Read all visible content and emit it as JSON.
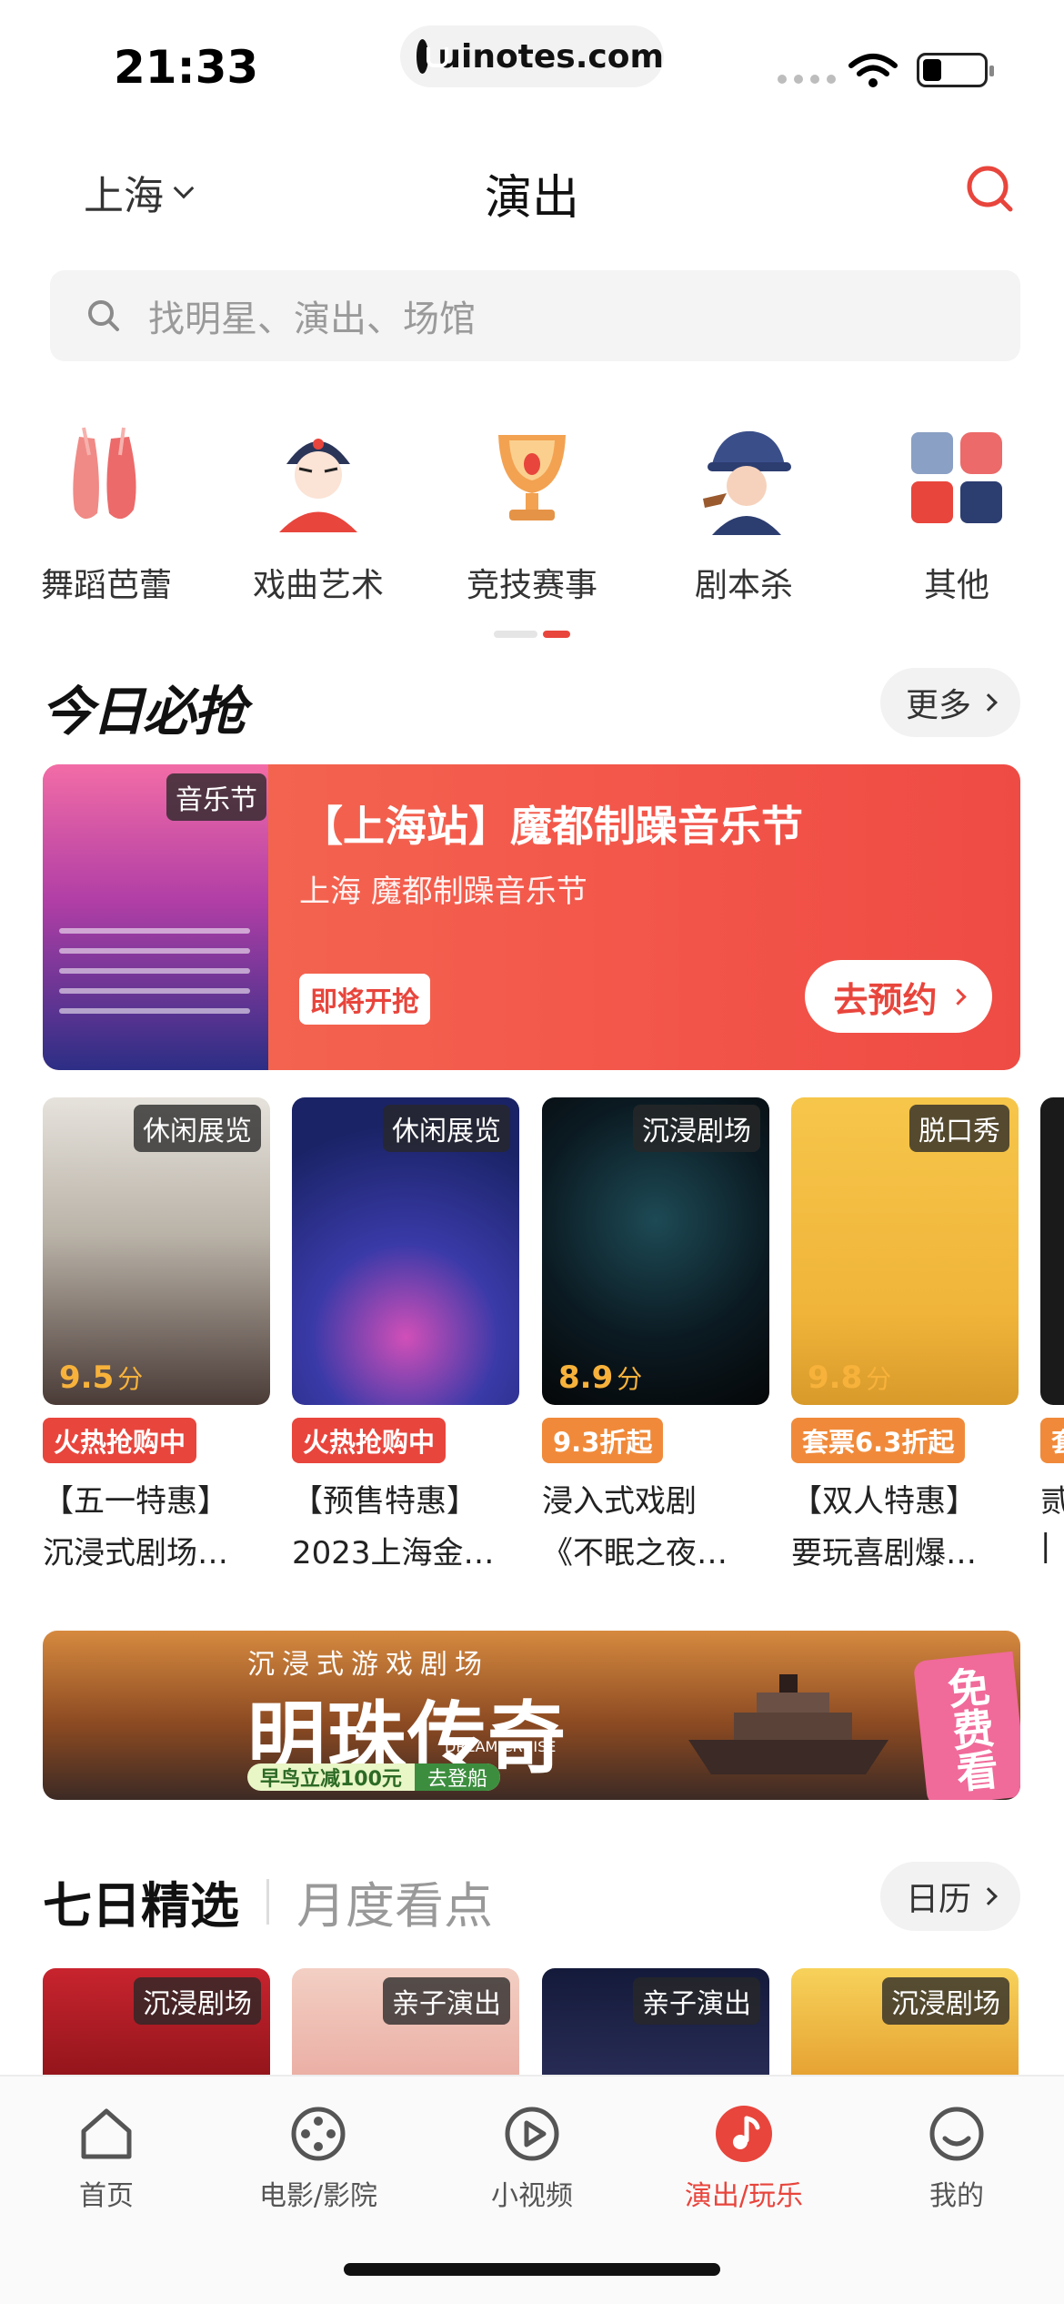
{
  "status_bar": {
    "time": "21:33",
    "url": "uinotes.com"
  },
  "header": {
    "city": "上海",
    "title": "演出"
  },
  "search": {
    "placeholder": "找明星、演出、场馆"
  },
  "categories": [
    {
      "label": "舞蹈芭蕾",
      "icon": "ballet-shoes-icon"
    },
    {
      "label": "戏曲艺术",
      "icon": "opera-mask-icon"
    },
    {
      "label": "竞技赛事",
      "icon": "trophy-icon"
    },
    {
      "label": "剧本杀",
      "icon": "detective-icon"
    },
    {
      "label": "其他",
      "icon": "grid-icon"
    }
  ],
  "today": {
    "title": "今日必抢",
    "more": "更多",
    "featured": {
      "tag": "音乐节",
      "title": "【上海站】魔都制躁音乐节",
      "subtitle": "上海 魔都制躁音乐节",
      "status": "即将开抢",
      "action": "去预约"
    },
    "shows": [
      {
        "tag": "休闲展览",
        "score": "9.5",
        "score_unit": "分",
        "badge": "火热抢购中",
        "badge_color": "#e8453c",
        "line1": "【五一特惠】",
        "line2": "沉浸式剧场…"
      },
      {
        "tag": "休闲展览",
        "score": "",
        "score_unit": "",
        "badge": "火热抢购中",
        "badge_color": "#e8453c",
        "line1": "【预售特惠】",
        "line2": "2023上海金…"
      },
      {
        "tag": "沉浸剧场",
        "score": "8.9",
        "score_unit": "分",
        "badge": "9.3折起",
        "badge_color": "#f08a3a",
        "line1": "浸入式戏剧",
        "line2": "《不眠之夜…"
      },
      {
        "tag": "脱口秀",
        "score": "9.8",
        "score_unit": "分",
        "badge": "套票6.3折起",
        "badge_color": "#f08a3a",
        "line1": "【双人特惠】",
        "line2": "要玩喜剧爆…"
      },
      {
        "tag": "",
        "score": "",
        "score_unit": "",
        "badge": "套",
        "badge_color": "#f08a3a",
        "line1": "贰",
        "line2": "|"
      }
    ]
  },
  "ad": {
    "subtitle": "沉浸式游戏剧场",
    "title": "明珠传奇",
    "english": "DREAM CRUISE",
    "promo": "早鸟立减100元",
    "promo_action": "去登船",
    "side": "免费看"
  },
  "weekly": {
    "tab_active": "七日精选",
    "tab_inactive": "月度看点",
    "calendar": "日历",
    "shows": [
      {
        "tag": "沉浸剧场"
      },
      {
        "tag": "亲子演出"
      },
      {
        "tag": "亲子演出"
      },
      {
        "tag": "沉浸剧场"
      }
    ]
  },
  "tabbar": [
    {
      "label": "首页",
      "icon": "home-icon",
      "active": false
    },
    {
      "label": "电影/影院",
      "icon": "film-reel-icon",
      "active": false
    },
    {
      "label": "小视频",
      "icon": "play-icon",
      "active": false
    },
    {
      "label": "演出/玩乐",
      "icon": "music-note-icon",
      "active": true
    },
    {
      "label": "我的",
      "icon": "profile-icon",
      "active": false
    }
  ],
  "colors": {
    "accent": "#e8453c",
    "score": "#f7b23b"
  }
}
